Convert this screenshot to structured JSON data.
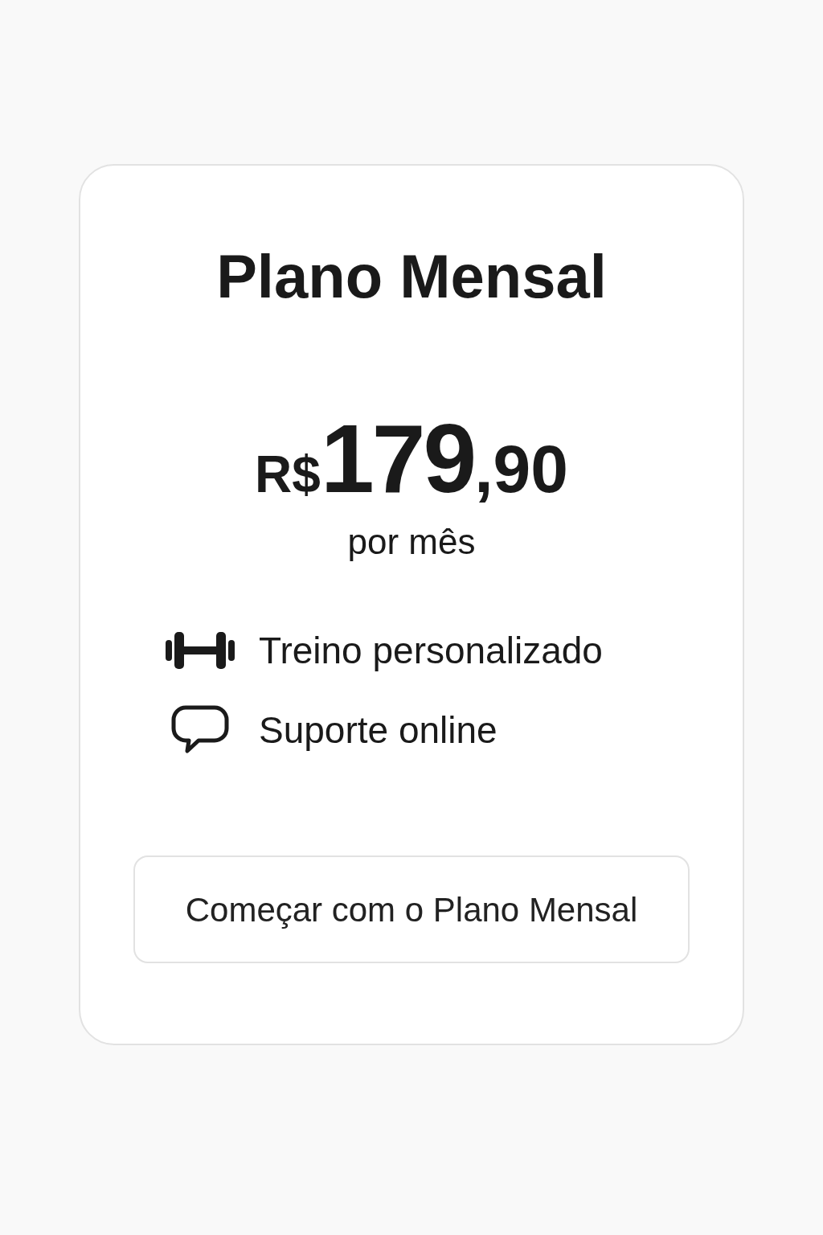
{
  "plan": {
    "title": "Plano Mensal",
    "price": {
      "currency": "R$",
      "amount": "179",
      "cents": ",90"
    },
    "period": "por mês",
    "features": [
      {
        "label": "Treino personalizado"
      },
      {
        "label": "Suporte online"
      }
    ],
    "button": "Começar com o Plano Mensal"
  }
}
